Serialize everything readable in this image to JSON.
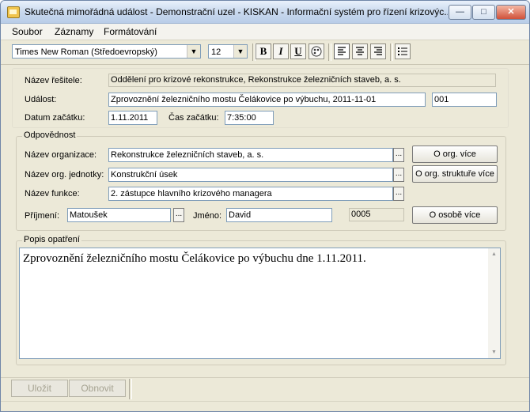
{
  "window": {
    "title": "Skutečná mimořádná událost - Demonstrační uzel - KISKAN - Informační systém pro řízení krizovýc...",
    "min_label": "—",
    "max_label": "□",
    "close_label": "✕"
  },
  "menu": {
    "soubor": "Soubor",
    "zaznamy": "Záznamy",
    "formatovani": "Formátování"
  },
  "toolbar": {
    "font": "Times New Roman (Středoevropský)",
    "size": "12",
    "bold": "B",
    "italic": "I",
    "underline": "U"
  },
  "form": {
    "nazev_resitele_label": "Název řešitele:",
    "nazev_resitele": "Oddělení pro krizové rekonstrukce, Rekonstrukce železničních staveb, a. s.",
    "udalost_label": "Událost:",
    "udalost": "Zprovoznění železničního mostu Čelákovice po výbuchu, 2011-11-01",
    "udalost_code": "001",
    "datum_label": "Datum začátku:",
    "datum": "1.11.2011",
    "cas_label": "Čas začátku:",
    "cas": "7:35:00"
  },
  "odpovednost": {
    "title": "Odpovědnost",
    "org_label": "Název organizace:",
    "org": "Rekonstrukce železničních staveb, a. s.",
    "unit_label": "Název org. jednotky:",
    "unit": "Konstrukční úsek",
    "func_label": "Název funkce:",
    "func": "2. zástupce hlavního krizového managera",
    "surname_label": "Příjmení:",
    "surname": "Matoušek",
    "name_label": "Jméno:",
    "name": "David",
    "person_code": "0005",
    "btn_org_more": "O org. více",
    "btn_org_struct": "O org. struktuře více",
    "btn_person_more": "O osobě více",
    "dots": "..."
  },
  "popis": {
    "title": "Popis opatření",
    "text": "Zprovoznění železničního mostu Čelákovice po výbuchu dne 1.11.2011."
  },
  "buttons": {
    "save": "Uložit",
    "refresh": "Obnovit"
  }
}
